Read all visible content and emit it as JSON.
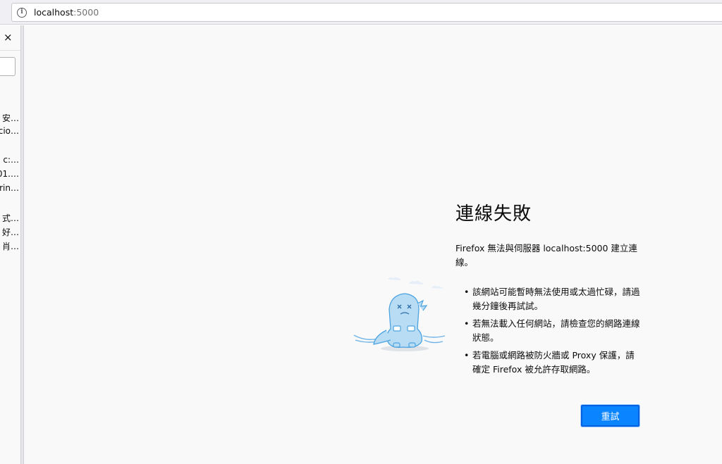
{
  "urlbar": {
    "host": "localhost",
    "port": ":5000",
    "info_icon": "info-icon"
  },
  "sidebar": {
    "close_label": "×",
    "items": [
      "安…",
      "cio…",
      "c:…",
      "01.…",
      "rin…",
      "式…",
      "好…",
      "肖…"
    ]
  },
  "error": {
    "title": "連線失敗",
    "description": "Firefox 無法與伺服器 localhost:5000 建立連線。",
    "bullets": [
      "該網站可能暫時無法使用或太過忙碌，請過幾分鐘後再試試。",
      "若無法載入任何網站，請檢查您的網路連線狀態。",
      "若電腦或網路被防火牆或 Proxy 保護，請確定 Firefox 被允許存取網路。"
    ],
    "retry_label": "重試"
  },
  "colors": {
    "accent": "#0a84ff",
    "accent_border": "#0060df",
    "background": "#f9f9fa"
  }
}
